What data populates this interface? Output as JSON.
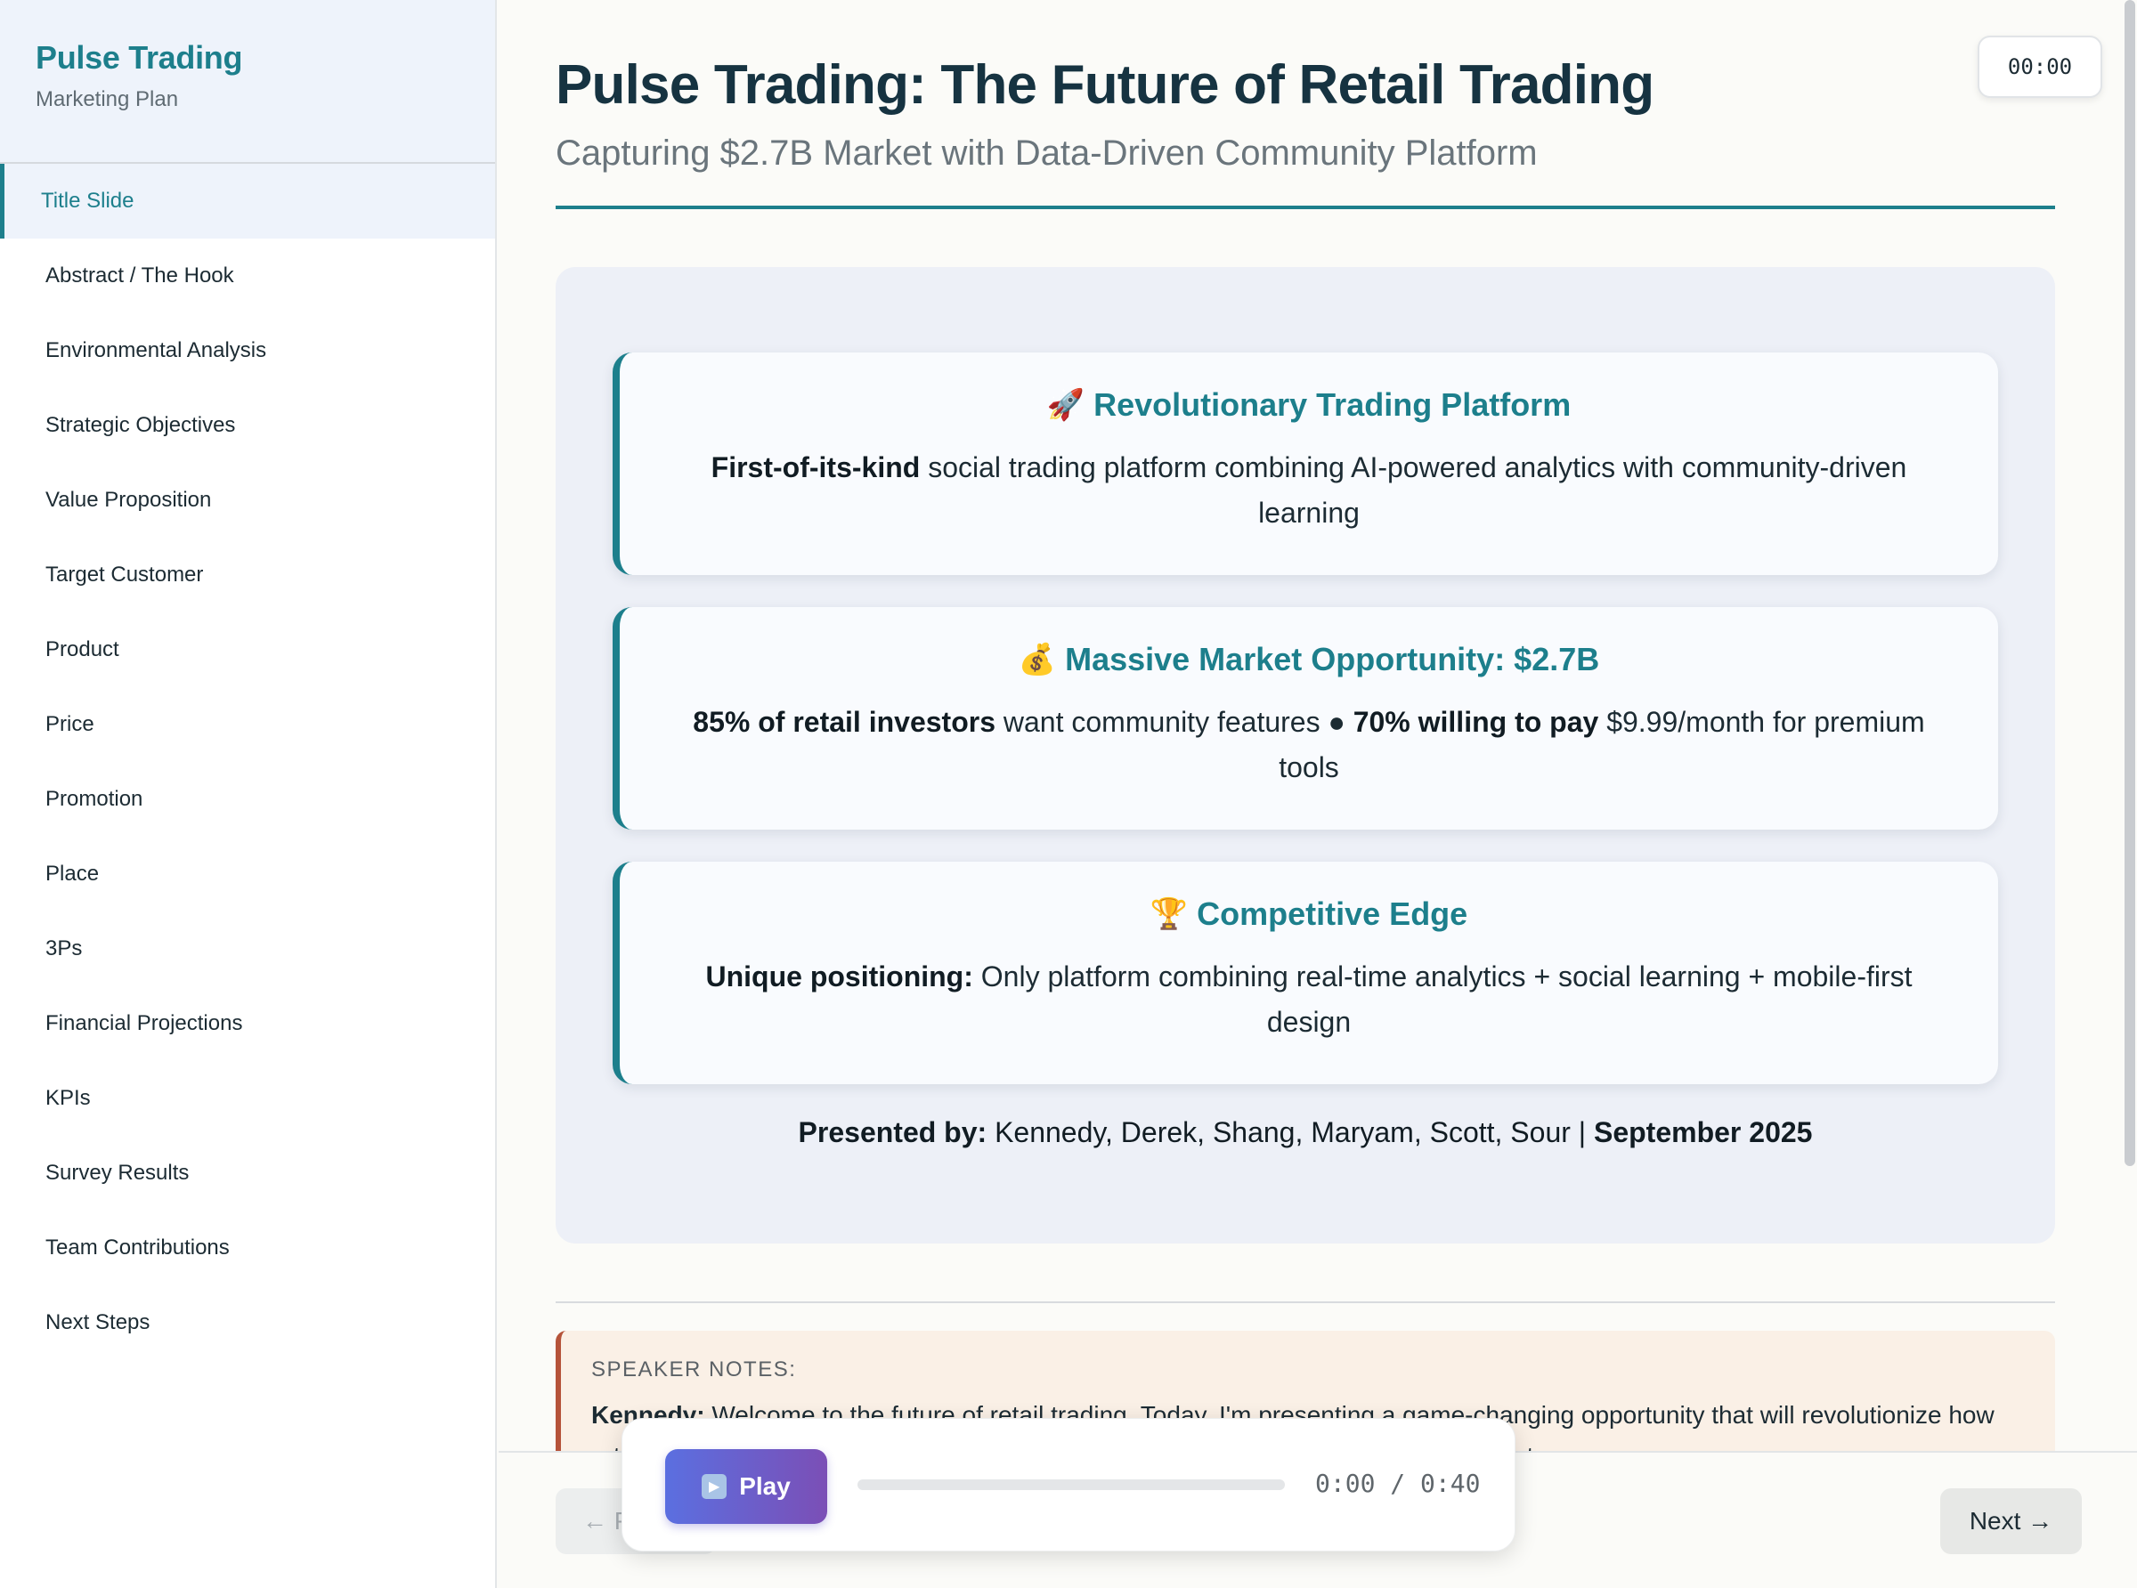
{
  "sidebar": {
    "brand_title": "Pulse Trading",
    "brand_subtitle": "Marketing Plan",
    "items": [
      {
        "label": "Title Slide",
        "active": true
      },
      {
        "label": "Abstract / The Hook"
      },
      {
        "label": "Environmental Analysis"
      },
      {
        "label": "Strategic Objectives"
      },
      {
        "label": "Value Proposition"
      },
      {
        "label": "Target Customer"
      },
      {
        "label": "Product"
      },
      {
        "label": "Price"
      },
      {
        "label": "Promotion"
      },
      {
        "label": "Place"
      },
      {
        "label": "3Ps"
      },
      {
        "label": "Financial Projections"
      },
      {
        "label": "KPIs"
      },
      {
        "label": "Survey Results"
      },
      {
        "label": "Team Contributions"
      },
      {
        "label": "Next Steps"
      }
    ]
  },
  "slide": {
    "title": "Pulse Trading: The Future of Retail Trading",
    "subtitle": "Capturing $2.7B Market with Data-Driven Community Platform",
    "timer": "00:00",
    "cards": [
      {
        "icon": "🚀",
        "icon_name": "rocket-icon",
        "heading": "Revolutionary Trading Platform",
        "strong1": "First-of-its-kind",
        "text1": " social trading platform combining AI-powered analytics with community-driven learning",
        "strong2": "",
        "text2": ""
      },
      {
        "icon": "💰",
        "icon_name": "money-bag-icon",
        "heading": "Massive Market Opportunity: $2.7B",
        "strong1": "85% of retail investors",
        "text1": " want community features ● ",
        "strong2": "70% willing to pay",
        "text2": " $9.99/month for premium tools"
      },
      {
        "icon": "🏆",
        "icon_name": "trophy-icon",
        "heading": "Competitive Edge",
        "strong1": "Unique positioning:",
        "text1": " Only platform combining real-time analytics + social learning + mobile-first design",
        "strong2": "",
        "text2": ""
      }
    ],
    "presented_label": "Presented by:",
    "presenters": " Kennedy, Derek, Shang, Maryam, Scott, Sour | ",
    "presented_date": "September 2025"
  },
  "notes": {
    "label": "SPEAKER NOTES:",
    "speaker": "Kennedy:",
    "text": " Welcome to the future of retail trading. Today, I'm presenting a game-changing opportunity that will revolutionize how retail investors trade, learn, and build wealth together with the first social trading app to"
  },
  "nav": {
    "prev_label": "← Previous",
    "next_label": "Next →"
  },
  "player": {
    "play_label": "Play",
    "time": "0:00 / 0:40",
    "progress": 0
  },
  "colors": {
    "accent": "#1d7f8c",
    "notes_accent": "#b5533a",
    "play_gradient_start": "#5b6fe0",
    "play_gradient_end": "#7b4fb6"
  }
}
